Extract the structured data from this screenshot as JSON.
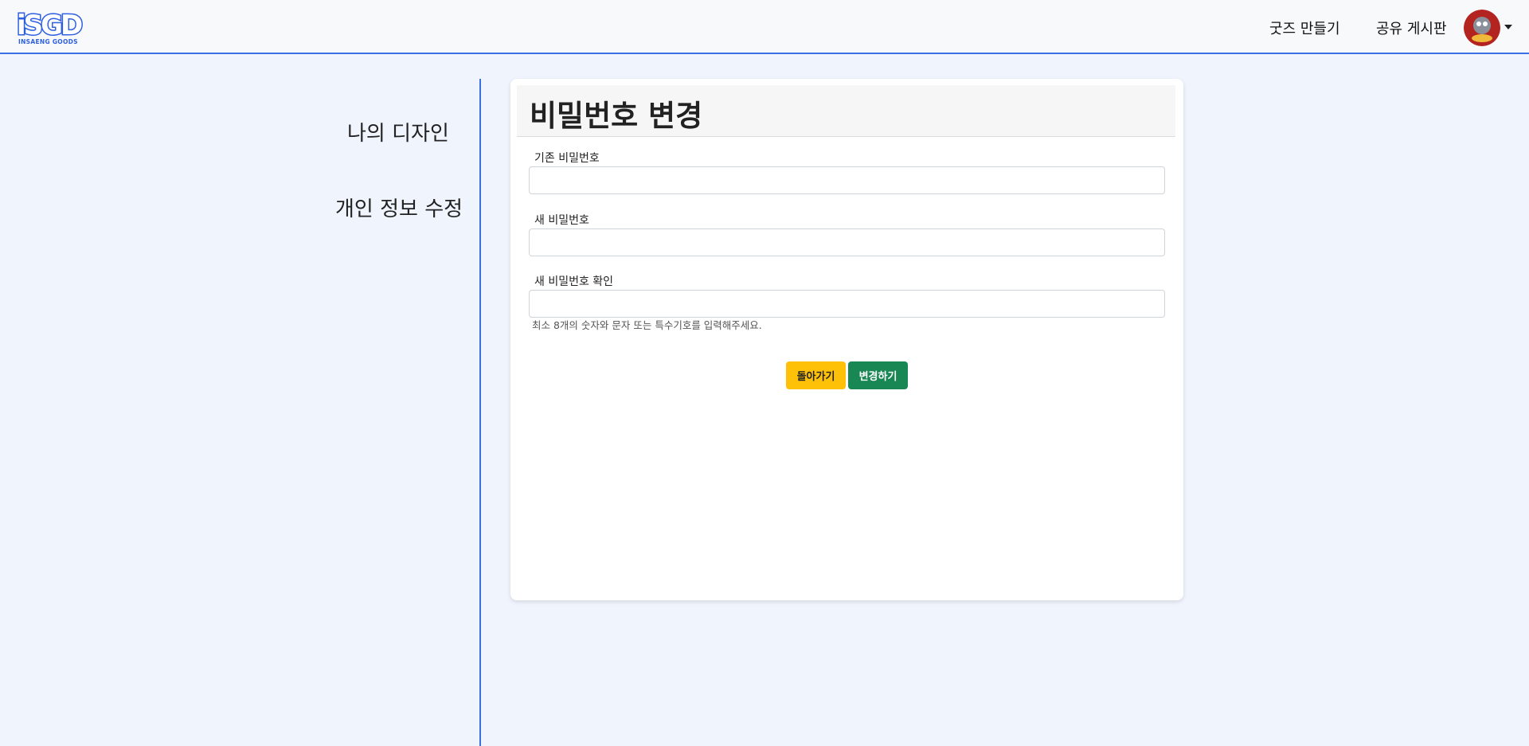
{
  "navbar": {
    "logo_text": "iSGD",
    "logo_subtext": "INSAENG GOODS",
    "links": [
      {
        "label": "굿즈 만들기"
      },
      {
        "label": "공유 게시판"
      }
    ],
    "accent_color": "#3b6fe6"
  },
  "sidebar": {
    "items": [
      {
        "label": "나의 디자인"
      },
      {
        "label": "개인 정보 수정"
      }
    ]
  },
  "form": {
    "title": "비밀번호 변경",
    "fields": [
      {
        "label": "기존 비밀번호",
        "value": ""
      },
      {
        "label": "새 비밀번호",
        "value": ""
      },
      {
        "label": "새 비밀번호 확인",
        "value": ""
      }
    ],
    "helper": "최소 8개의 숫자와 문자 또는 특수기호를 입력해주세요.",
    "buttons": {
      "back": "돌아가기",
      "submit": "변경하기"
    }
  },
  "colors": {
    "page_bg": "#f0f4fd",
    "back_button": "#ffc107",
    "submit_button": "#198754"
  }
}
